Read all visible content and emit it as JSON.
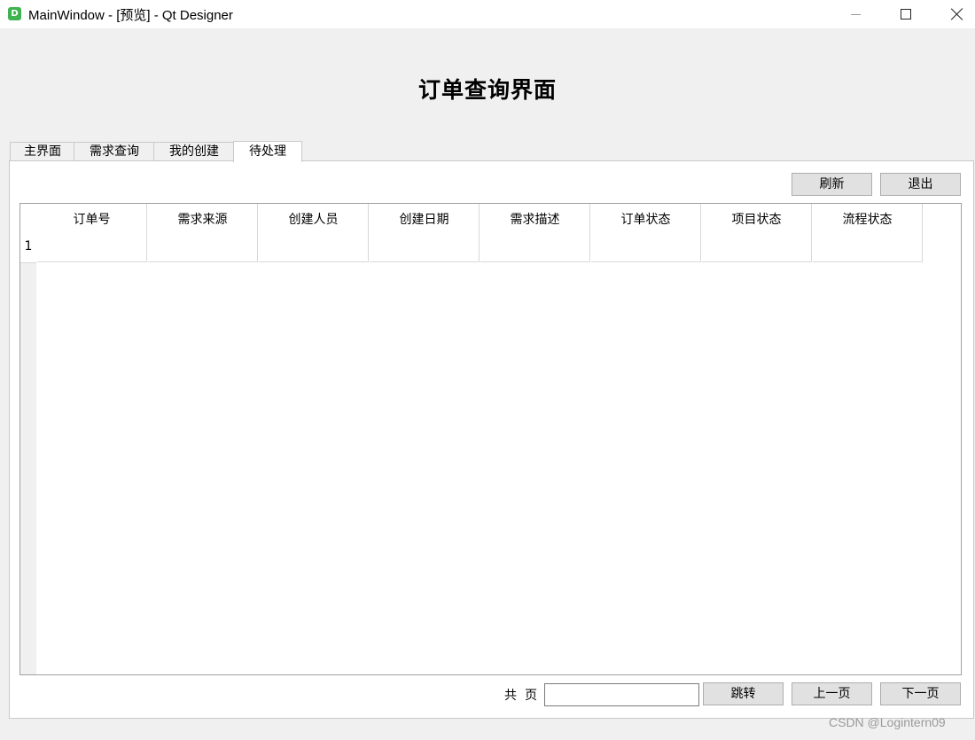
{
  "window": {
    "app_icon_letter": "D",
    "title": "MainWindow - [预览] - Qt Designer"
  },
  "page_title": "订单查询界面",
  "tabs": [
    {
      "label": "主界面"
    },
    {
      "label": "需求查询"
    },
    {
      "label": "我的创建"
    },
    {
      "label": "待处理",
      "active": true
    }
  ],
  "toolbar": {
    "refresh_label": "刷新",
    "exit_label": "退出"
  },
  "table": {
    "columns": [
      "订单号",
      "需求来源",
      "创建人员",
      "创建日期",
      "需求描述",
      "订单状态",
      "项目状态",
      "流程状态"
    ],
    "row_numbers": [
      "1"
    ]
  },
  "pager": {
    "total_label": "共",
    "page_label": "页",
    "page_input_value": "",
    "jump_label": "跳转",
    "prev_label": "上一页",
    "next_label": "下一页"
  },
  "watermark": "CSDN @Logintern09"
}
